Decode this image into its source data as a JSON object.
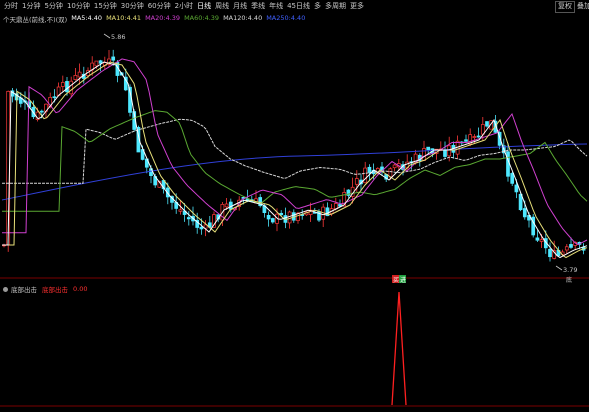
{
  "toolbar": {
    "items": [
      "分时",
      "1分钟",
      "5分钟",
      "10分钟",
      "15分钟",
      "30分钟",
      "60分钟",
      "2小时",
      "日线",
      "周线",
      "月线",
      "季线",
      "年线",
      "45日线",
      "多",
      "多周期",
      "更多"
    ],
    "active_index": 8,
    "right_buttons": [
      "复权",
      "叠加"
    ]
  },
  "info": {
    "title": "个天鼎丛(前线,不)(双)",
    "ma5": "MA5:4.40",
    "ma10": "MA10:4.41",
    "ma20": "MA20:4.39",
    "ma60": "MA60:4.39",
    "ma120": "MA120:4.40",
    "ma250": "MA250:4.40"
  },
  "indicator": {
    "name": "底部出击",
    "label": "底部出击",
    "value": "0.00",
    "signal_tag_1": "买",
    "signal_tag_2": "进"
  },
  "annotations": {
    "high_price": "5.86",
    "low_price": "3.79",
    "low_tag": "底"
  },
  "colors": {
    "up": "#ff3a3a",
    "down": "#4ee8ff",
    "ma5": "#ffffff",
    "ma10": "#e8e07a",
    "ma20": "#d040d0",
    "ma60": "#5aa832",
    "ma120": "#d9d9d9",
    "ma250": "#3040d8",
    "signal": "#ff2020"
  }
}
